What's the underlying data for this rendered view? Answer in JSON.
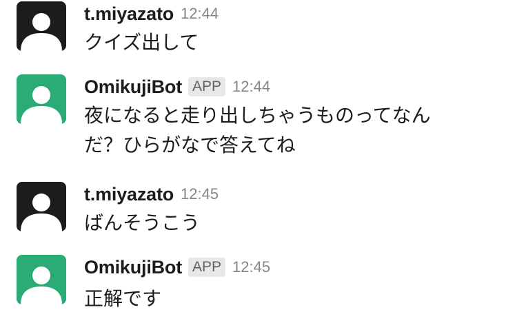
{
  "messages": [
    {
      "author": "t.miyazato",
      "is_app": false,
      "time": "12:44",
      "avatar_color": "#1d1c1d",
      "lines": [
        "クイズ出して"
      ]
    },
    {
      "author": "OmikujiBot",
      "is_app": true,
      "app_label": "APP",
      "time": "12:44",
      "avatar_color": "#2bac76",
      "lines": [
        "夜になると走り出しちゃうものってなん",
        "だ？ひらがなで答えてね"
      ]
    },
    {
      "author": "t.miyazato",
      "is_app": false,
      "time": "12:45",
      "avatar_color": "#1d1c1d",
      "lines": [
        "ばんそうこう"
      ]
    },
    {
      "author": "OmikujiBot",
      "is_app": true,
      "app_label": "APP",
      "time": "12:45",
      "avatar_color": "#2bac76",
      "lines": [
        "正解です"
      ]
    }
  ]
}
